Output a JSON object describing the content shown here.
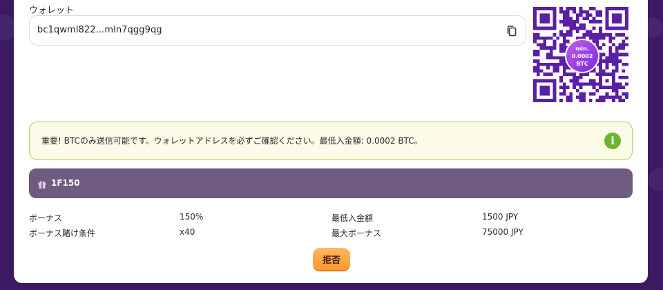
{
  "wallet": {
    "label": "ウォレット",
    "address": "bc1qwml822...mln7qgg9qg"
  },
  "qr": {
    "badge_line1": "min.",
    "badge_line2": "0.0002",
    "badge_line3": "BTC"
  },
  "notice": {
    "text": "重要! BTCのみ送信可能です。ウォレットアドレスを必ずご確認ください。最低入金額: 0.0002 BTC。"
  },
  "bonus": {
    "code": "1F150"
  },
  "details": {
    "bonus_label": "ボーナス",
    "bonus_value": "150%",
    "wager_label": "ボーナス賭け条件",
    "wager_value": "x40",
    "min_deposit_label": "最低入金額",
    "min_deposit_value": "1500 JPY",
    "max_bonus_label": "最大ボーナス",
    "max_bonus_value": "75000 JPY"
  },
  "actions": {
    "reject_label": "拒否"
  },
  "colors": {
    "background": "#3b1a63",
    "accent_purple": "#6f5a80",
    "qr_purple": "#5a1fa6",
    "notice_border": "#a6d35c",
    "info_green": "#6cb52c",
    "button_orange": "#ff9a2f"
  }
}
